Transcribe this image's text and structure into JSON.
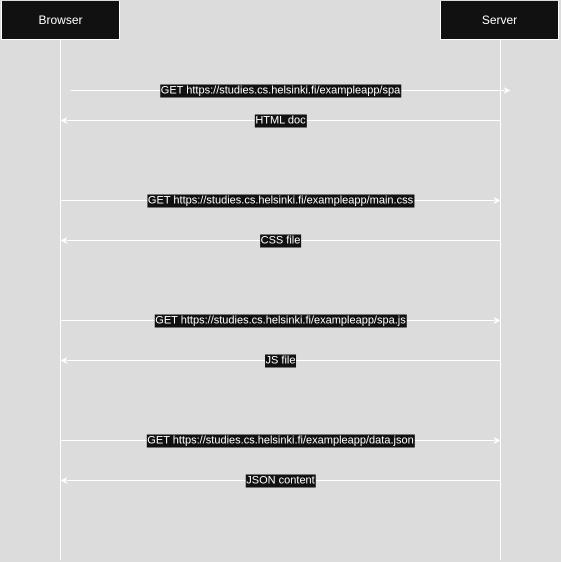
{
  "participants": {
    "browser": "Browser",
    "server": "Server"
  },
  "messages": [
    {
      "label": "GET https://studies.cs.helsinki.fi/exampleapp/spa",
      "direction": "to-server"
    },
    {
      "label": "HTML doc",
      "direction": "to-browser"
    },
    {
      "label": "GET https://studies.cs.helsinki.fi/exampleapp/main.css",
      "direction": "to-server"
    },
    {
      "label": "CSS file",
      "direction": "to-browser"
    },
    {
      "label": "GET https://studies.cs.helsinki.fi/exampleapp/spa.js",
      "direction": "to-server"
    },
    {
      "label": "JS file",
      "direction": "to-browser"
    },
    {
      "label": "GET https://studies.cs.helsinki.fi/exampleapp/data.json",
      "direction": "to-server"
    },
    {
      "label": "JSON content",
      "direction": "to-browser"
    }
  ],
  "colors": {
    "background": "#dcdcdc",
    "box": "#111111",
    "line": "#ffffff",
    "text": "#ffffff"
  }
}
